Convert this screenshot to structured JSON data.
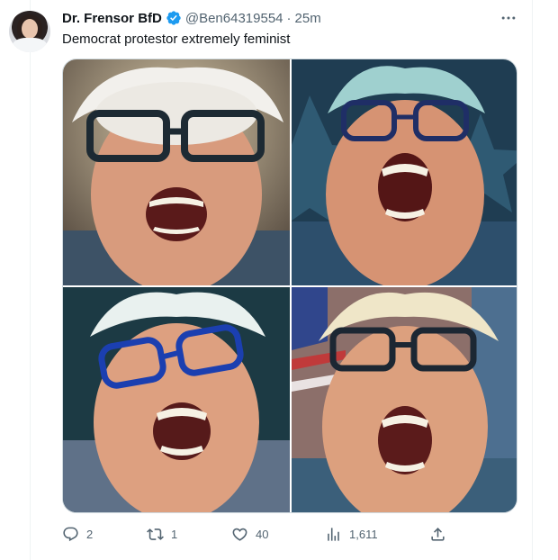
{
  "author": {
    "display_name": "Dr. Frensor BfD",
    "handle": "@Ben64319554",
    "separator": "·",
    "timestamp": "25m",
    "verified": true,
    "verified_color": "#1d9bf0"
  },
  "tweet": {
    "text": "Democrat protestor extremely feminist"
  },
  "media": {
    "count": 4
  },
  "actions": {
    "replies": "2",
    "retweets": "1",
    "likes": "40",
    "views": "1,611"
  },
  "icons": {
    "more": "more-horizontal-icon",
    "reply": "reply-icon",
    "retweet": "retweet-icon",
    "like": "heart-icon",
    "views": "views-icon",
    "share": "share-icon"
  },
  "colors": {
    "secondary_text": "#536471",
    "border": "#cfd9de"
  }
}
